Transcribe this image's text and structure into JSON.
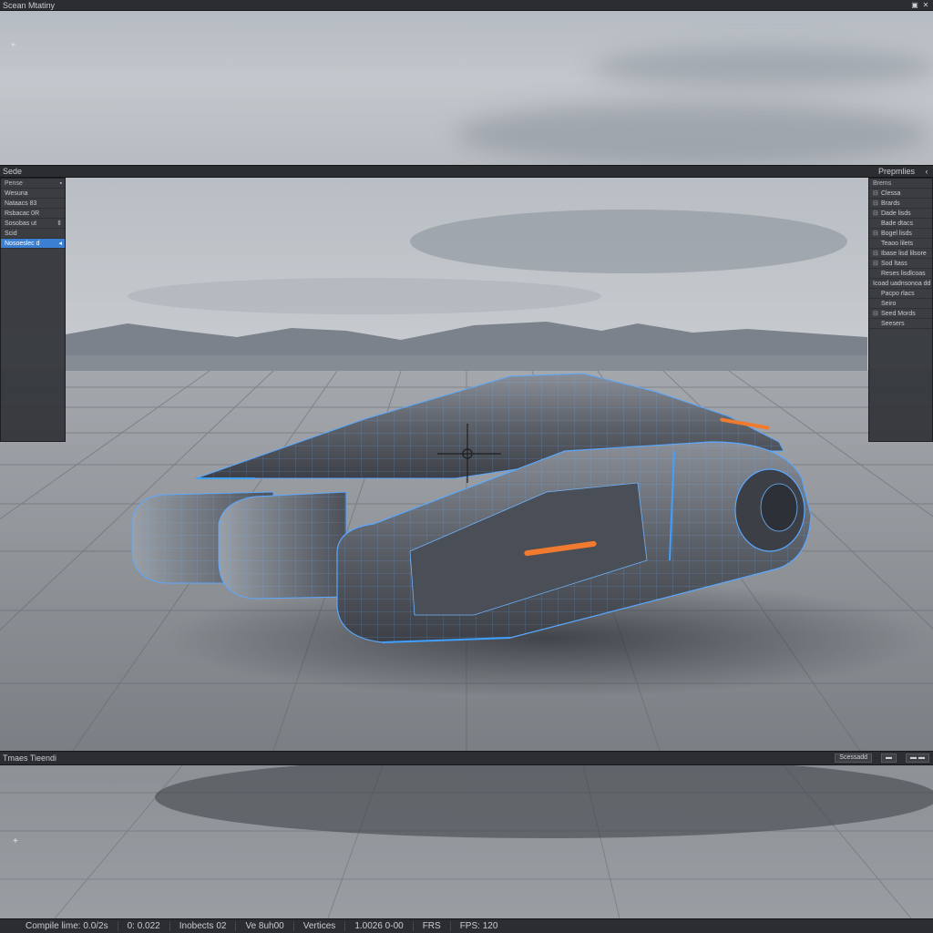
{
  "window": {
    "title": "Scean Mtatiny",
    "controls": [
      "▣",
      "✕"
    ]
  },
  "scene_bar": {
    "left_label": "Sede",
    "right_label": "Prepmlies",
    "collapse_icon": "‹"
  },
  "outliner": {
    "header": "Pense",
    "items": [
      {
        "label": "Wesuna",
        "tail": ""
      },
      {
        "label": "Nataacs 83",
        "tail": ""
      },
      {
        "label": "Rsbacac 0R",
        "tail": ""
      },
      {
        "label": "Sosobas ut",
        "tail": "⇕"
      },
      {
        "label": "Scid",
        "tail": ""
      },
      {
        "label": "Nosoeslec d",
        "tail": "◂",
        "selected": true
      }
    ]
  },
  "properties": {
    "header": "Brems",
    "items": [
      {
        "pre": "⊟",
        "label": "Clessa"
      },
      {
        "pre": "⊟",
        "label": "Brards"
      },
      {
        "pre": "⊟",
        "label": "Dade lisds"
      },
      {
        "pre": "",
        "label": "Bade dtacs"
      },
      {
        "pre": "⊟",
        "label": "Bogel lisds"
      },
      {
        "pre": "",
        "label": "Teaoo lilets"
      },
      {
        "pre": "⊟",
        "label": "Ibase lisd lilsore"
      },
      {
        "pre": "⊟",
        "label": "Sod ltass"
      },
      {
        "pre": "",
        "label": "Reses lisdlcoas"
      },
      {
        "pre": "",
        "label": "Icoad uadnsonoa dd lns"
      },
      {
        "pre": "",
        "label": "Pacpo rlacs"
      },
      {
        "pre": "",
        "label": "Seiro"
      },
      {
        "pre": "⊟",
        "label": "Seed Mords"
      },
      {
        "pre": "",
        "label": "Seesers"
      }
    ]
  },
  "timeline_bar": {
    "label": "Tmaes Tieendi",
    "buttons": [
      "Scessadd",
      "▬",
      "▬ ▬"
    ]
  },
  "status_bar": {
    "items": [
      "Compile lime: 0.0/2s",
      "0: 0.022",
      "Inobects 02",
      "Ve 8uh00",
      "Vertices",
      "1.0026 0-00",
      "FRS",
      "FPS: 120"
    ]
  },
  "colors": {
    "accent": "#3b7fd1",
    "wire": "#5aa8ff",
    "thruster": "#f07a2e",
    "body": "#5a5e66"
  },
  "icons": {
    "viewport_origin_top": "crosshair-icon",
    "viewport_origin_bottom": "crosshair-icon",
    "gizmo": "transform-gizmo-icon"
  }
}
